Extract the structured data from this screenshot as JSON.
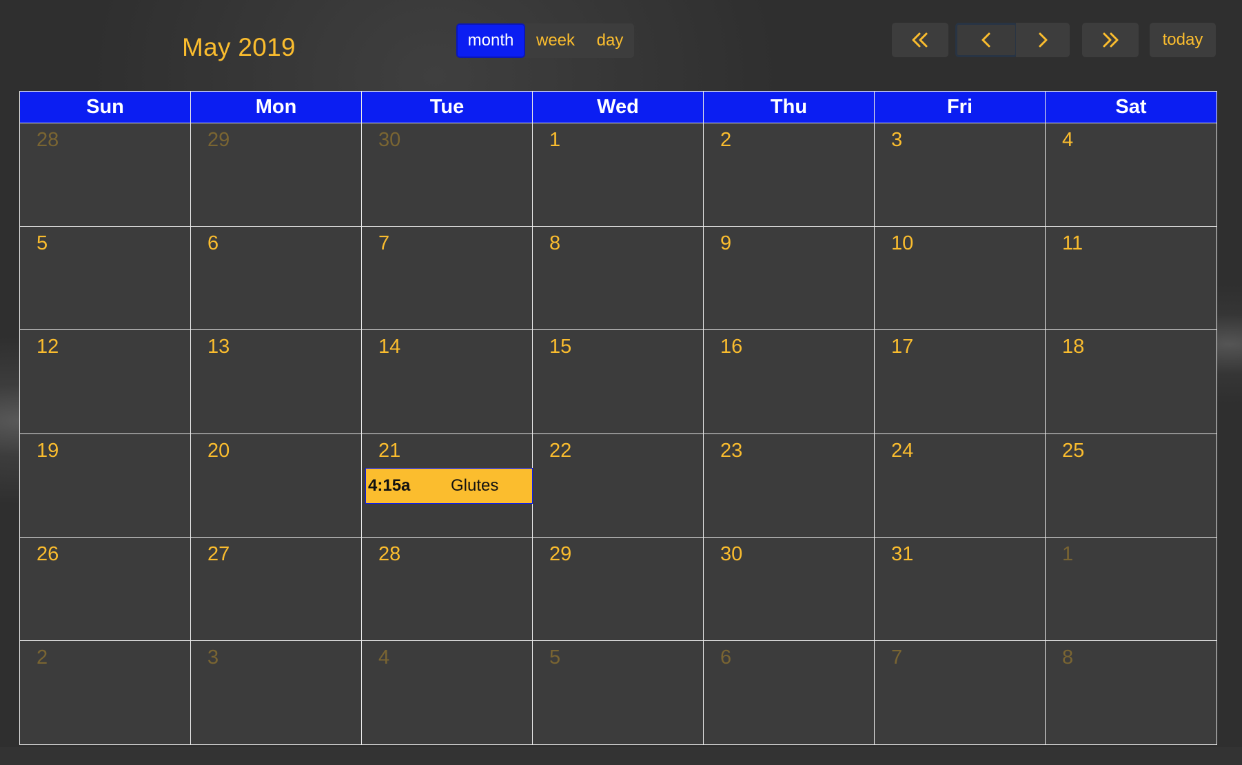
{
  "toolbar": {
    "title": "May 2019",
    "views": [
      "month",
      "week",
      "day"
    ],
    "active_view": "month",
    "today_label": "today"
  },
  "nav": {
    "prev_year_icon": "double-chevron-left-icon",
    "prev_icon": "chevron-left-icon",
    "next_icon": "chevron-right-icon",
    "next_year_icon": "double-chevron-right-icon"
  },
  "weekdays": [
    "Sun",
    "Mon",
    "Tue",
    "Wed",
    "Thu",
    "Fri",
    "Sat"
  ],
  "weeks": [
    [
      {
        "n": "28",
        "other": true
      },
      {
        "n": "29",
        "other": true
      },
      {
        "n": "30",
        "other": true
      },
      {
        "n": "1"
      },
      {
        "n": "2"
      },
      {
        "n": "3"
      },
      {
        "n": "4"
      }
    ],
    [
      {
        "n": "5"
      },
      {
        "n": "6"
      },
      {
        "n": "7"
      },
      {
        "n": "8"
      },
      {
        "n": "9"
      },
      {
        "n": "10"
      },
      {
        "n": "11"
      }
    ],
    [
      {
        "n": "12"
      },
      {
        "n": "13"
      },
      {
        "n": "14"
      },
      {
        "n": "15"
      },
      {
        "n": "16"
      },
      {
        "n": "17"
      },
      {
        "n": "18"
      }
    ],
    [
      {
        "n": "19"
      },
      {
        "n": "20"
      },
      {
        "n": "21",
        "event": {
          "time": "4:15a",
          "title": "Glutes"
        }
      },
      {
        "n": "22"
      },
      {
        "n": "23"
      },
      {
        "n": "24"
      },
      {
        "n": "25"
      }
    ],
    [
      {
        "n": "26"
      },
      {
        "n": "27"
      },
      {
        "n": "28"
      },
      {
        "n": "29"
      },
      {
        "n": "30"
      },
      {
        "n": "31"
      },
      {
        "n": "1",
        "other": true
      }
    ],
    [
      {
        "n": "2",
        "other": true
      },
      {
        "n": "3",
        "other": true
      },
      {
        "n": "4",
        "other": true
      },
      {
        "n": "5",
        "other": true
      },
      {
        "n": "6",
        "other": true
      },
      {
        "n": "7",
        "other": true
      },
      {
        "n": "8",
        "other": true
      }
    ]
  ],
  "colors": {
    "accent": "#fbbd2e",
    "header_blue": "#0b1ef2",
    "cell_bg": "#3c3c3c"
  }
}
